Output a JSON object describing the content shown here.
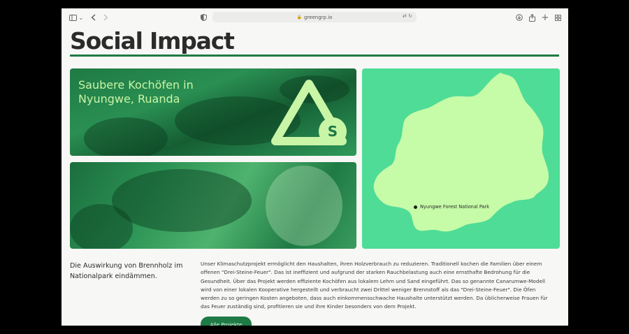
{
  "browser": {
    "url": "greengrp.io",
    "icons": {
      "sidebar": "sidebar-icon",
      "chevron": "chevron-down-icon",
      "back": "back-icon",
      "forward": "forward-icon",
      "shield": "shield-icon",
      "lock": "lock-icon",
      "translate": "translate-icon",
      "reload": "reload-icon",
      "download": "download-icon",
      "share": "share-icon",
      "new_tab": "plus-icon",
      "tabs": "tab-overview-icon"
    }
  },
  "page": {
    "title": "Social Impact",
    "project": {
      "heading": "Saubere Kochöfen in Nyungwe, Ruanda",
      "logo_letter": "S"
    },
    "map": {
      "location_label": "Nyungwe Forest National Park"
    },
    "subtitle": "Die Auswirkung von Brennholz im Nationalpark eindämmen.",
    "description": "Unser Klimaschutzprojekt ermöglicht den Haushalten, ihren Holzverbrauch zu reduzieren. Traditionell kochen die Familien über einem offenen \"Drei-Steine-Feuer\". Das ist ineffizient und aufgrund der starken Rauchbelastung auch eine ernsthafte Bedrohung für die Gesundheit. Über das Projekt werden effiziente Kochöfen aus lokalem Lehm und Sand eingeführt. Das so genannte Canarumwe-Modell wird von einer lokalen Kooperative hergestellt und verbraucht zwei Drittel weniger Brennstoff als das \"Drei-Steine-Feuer\". Die Öfen werden zu so geringen Kosten angeboten, dass auch einkommensschwache Haushalte unterstützt werden. Da üblicherweise Frauen für das Feuer zuständig sind, profitieren sie und ihre Kinder besonders von dem Projekt.",
    "cta_label": "Alle Projekte"
  },
  "colors": {
    "accent": "#1f7a46",
    "map_bg": "#4fdc96",
    "map_land": "#c6fba8",
    "logo": "#c9f5a6"
  }
}
